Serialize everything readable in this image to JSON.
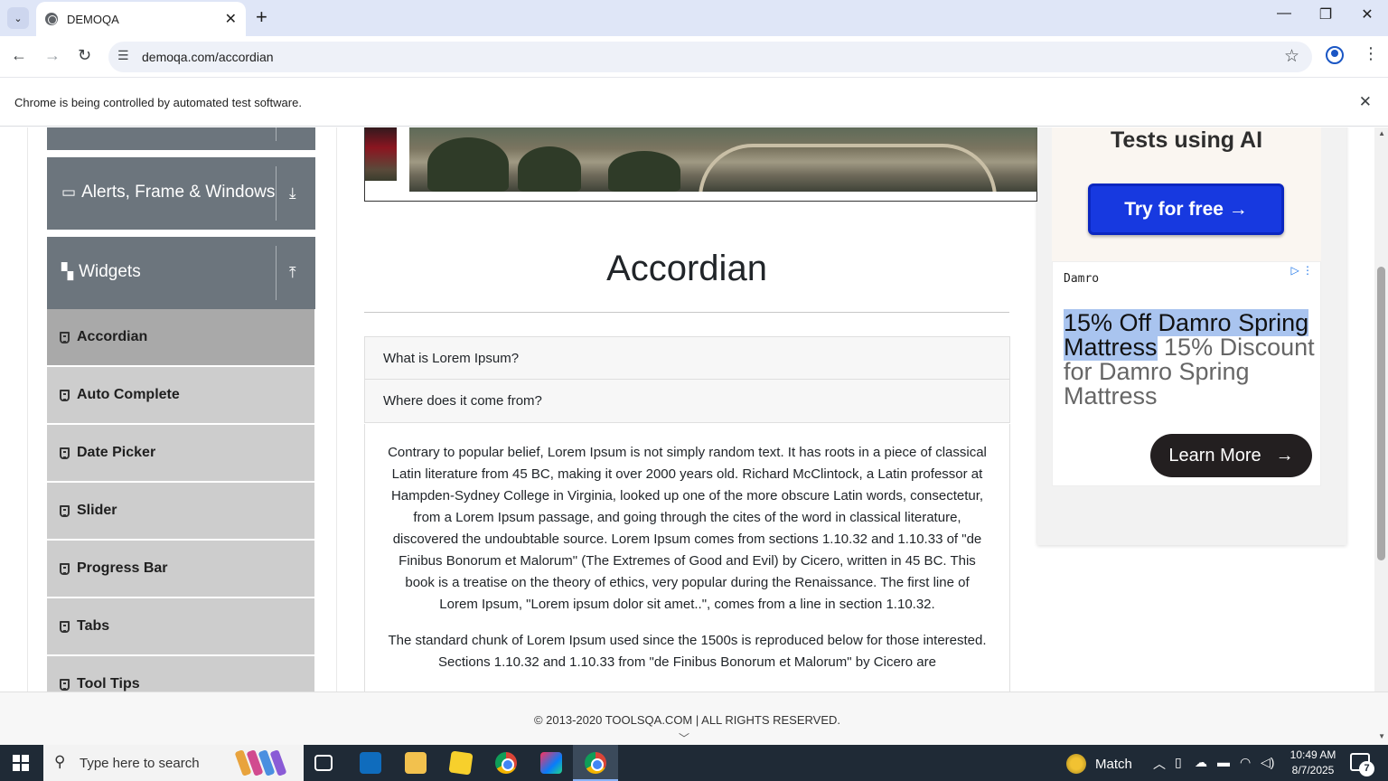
{
  "browser": {
    "tab_title": "DEMOQA",
    "url": "demoqa.com/accordian",
    "infobar_message": "Chrome is being controlled by automated test software.",
    "icons": {
      "tab_search": "chevron-down-icon",
      "tab_close": "close-icon",
      "new_tab": "plus-icon",
      "minimize": "minimize-icon",
      "restore": "restore-icon",
      "close": "close-icon",
      "back": "arrow-left-icon",
      "forward": "arrow-right-icon",
      "reload": "reload-icon",
      "site_info": "tune-icon",
      "bookmark": "star-icon",
      "profile": "profile-icon",
      "menu": "kebab-icon"
    }
  },
  "sidebar": {
    "groups": [
      {
        "label": "Alerts, Frame & Windows",
        "icon": "window-icon",
        "toggle_icon": "arrow-down-icon"
      },
      {
        "label": "Widgets",
        "icon": "widgets-icon",
        "toggle_icon": "arrow-up-icon"
      }
    ],
    "items": [
      {
        "label": "Accordian",
        "active": true
      },
      {
        "label": "Auto Complete",
        "active": false
      },
      {
        "label": "Date Picker",
        "active": false
      },
      {
        "label": "Slider",
        "active": false
      },
      {
        "label": "Progress Bar",
        "active": false
      },
      {
        "label": "Tabs",
        "active": false
      },
      {
        "label": "Tool Tips",
        "active": false
      }
    ]
  },
  "main": {
    "title": "Accordian",
    "accordion": [
      {
        "header": "What is Lorem Ipsum?"
      },
      {
        "header": "Where does it come from?"
      }
    ],
    "body_paragraphs": [
      "Contrary to popular belief, Lorem Ipsum is not simply random text. It has roots in a piece of classical Latin literature from 45 BC, making it over 2000 years old. Richard McClintock, a Latin professor at Hampden-Sydney College in Virginia, looked up one of the more obscure Latin words, consectetur, from a Lorem Ipsum passage, and going through the cites of the word in classical literature, discovered the undoubtable source. Lorem Ipsum comes from sections 1.10.32 and 1.10.33 of \"de Finibus Bonorum et Malorum\" (The Extremes of Good and Evil) by Cicero, written in 45 BC. This book is a treatise on the theory of ethics, very popular during the Renaissance. The first line of Lorem Ipsum, \"Lorem ipsum dolor sit amet..\", comes from a line in section 1.10.32.",
      "The standard chunk of Lorem Ipsum used since the 1500s is reproduced below for those interested. Sections 1.10.32 and 1.10.33 from \"de Finibus Bonorum et Malorum\" by Cicero are"
    ]
  },
  "ads": {
    "ad1": {
      "headline": "Tests using AI",
      "cta": "Try for free →"
    },
    "ad2": {
      "advertiser": "Damro",
      "highlighted_text": "15% Off Damro Spring Mattress",
      "rest_text": " 15% Discount for Damro Spring Mattress",
      "cta": "Learn More"
    }
  },
  "footer": {
    "copyright": "© 2013-2020 TOOLSQA.COM | ALL RIGHTS RESERVED."
  },
  "taskbar": {
    "search_placeholder": "Type here to search",
    "weather": "Match",
    "time": "10:49 AM",
    "date": "8/7/2025",
    "notification_count": "7",
    "apps": [
      "task-view-icon",
      "outlook-icon",
      "file-explorer-icon",
      "sticky-notes-icon",
      "chrome-icon",
      "intellij-icon",
      "chrome-icon"
    ]
  }
}
